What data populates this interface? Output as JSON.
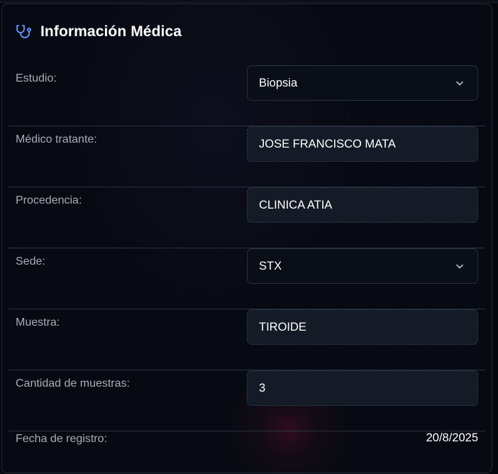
{
  "section": {
    "title": "Información Médica",
    "icon": "stethoscope-icon"
  },
  "fields": {
    "estudio": {
      "label": "Estudio:",
      "value": "Biopsia"
    },
    "medico": {
      "label": "Médico tratante:",
      "value": "JOSE FRANCISCO MATA"
    },
    "procedencia": {
      "label": "Procedencia:",
      "value": "CLINICA ATIA"
    },
    "sede": {
      "label": "Sede:",
      "value": "STX"
    },
    "muestra": {
      "label": "Muestra:",
      "value": "TIROIDE"
    },
    "cantidad": {
      "label": "Cantidad de muestras:",
      "value": "3"
    },
    "fecha": {
      "label": "Fecha de registro:",
      "value": "20/8/2025"
    }
  },
  "colors": {
    "accent_icon": "#5b8def",
    "background": "#070a12",
    "label": "#a6adb9",
    "value": "#ffffff"
  }
}
